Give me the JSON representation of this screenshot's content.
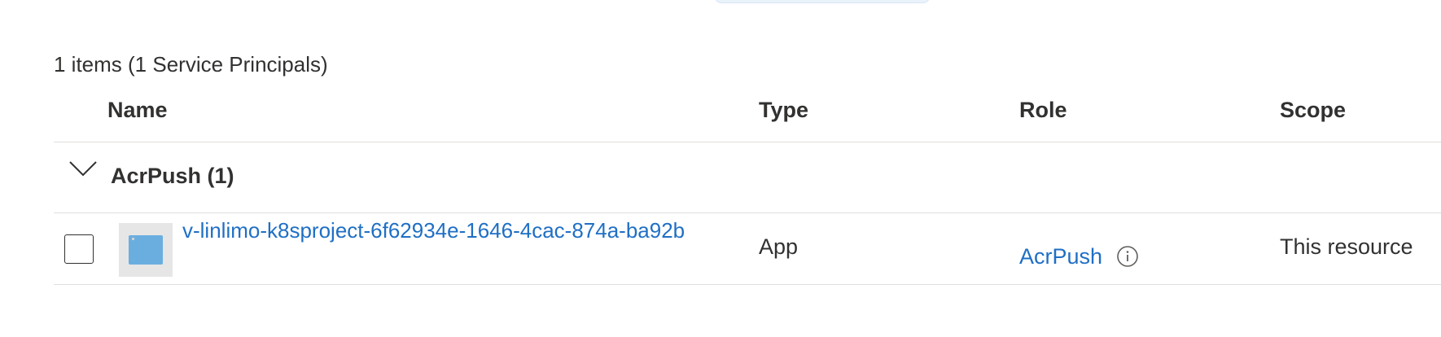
{
  "summary": "1 items (1 Service Principals)",
  "columns": {
    "name": "Name",
    "type": "Type",
    "role": "Role",
    "scope": "Scope"
  },
  "group": {
    "label": "AcrPush (1)",
    "expanded": true
  },
  "rows": [
    {
      "name": "v-linlimo-k8sproject-6f62934e-1646-4cac-874a-ba92b",
      "type": "App",
      "role": "AcrPush",
      "scope": "This resource",
      "icon": "app-registration-icon",
      "checked": false
    }
  ],
  "colors": {
    "link": "#1f6fc5",
    "text": "#323130",
    "divider": "#e1dfdd",
    "app_icon": "#6aaee0"
  }
}
